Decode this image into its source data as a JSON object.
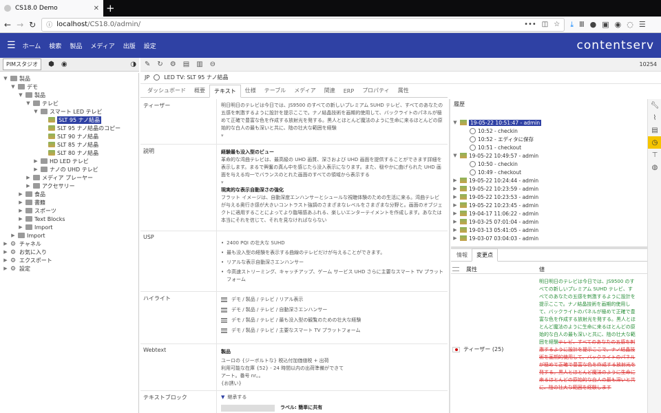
{
  "browser": {
    "tab_title": "CS18.0 Demo",
    "url_host": "localhost",
    "url_path": "/CS18.0/admin/",
    "more_label": "•••"
  },
  "app": {
    "menu": [
      "ホーム",
      "検索",
      "製品",
      "メディア",
      "出版",
      "設定"
    ],
    "logo": "contentserv",
    "accent_color": "#2f41a4",
    "record_id": "10254"
  },
  "left": {
    "tab_label": "PIMスタジオ",
    "tree": [
      {
        "label": "製品",
        "level": 0,
        "toggle": "▼",
        "icon": "fold"
      },
      {
        "label": "デモ",
        "level": 1,
        "toggle": "▼",
        "icon": "fold"
      },
      {
        "label": "製品",
        "level": 2,
        "toggle": "▼",
        "icon": "fold"
      },
      {
        "label": "テレビ",
        "level": 3,
        "toggle": "▼",
        "icon": "fold"
      },
      {
        "label": "スマート LED テレビ",
        "level": 4,
        "toggle": "▼",
        "icon": "fold"
      },
      {
        "label": "SLT 95 ナノ結晶",
        "level": 5,
        "toggle": "",
        "icon": "img",
        "selected": true
      },
      {
        "label": "SLT 95 ナノ結晶のコピー",
        "level": 5,
        "toggle": "",
        "icon": "img"
      },
      {
        "label": "SLT 90 ナノ結晶",
        "level": 5,
        "toggle": "",
        "icon": "img"
      },
      {
        "label": "SLT 85 ナノ結晶",
        "level": 5,
        "toggle": "",
        "icon": "img"
      },
      {
        "label": "SLT 80 ナノ結晶",
        "level": 5,
        "toggle": "",
        "icon": "img"
      },
      {
        "label": "HD LED テレビ",
        "level": 4,
        "toggle": "▶",
        "icon": "fold"
      },
      {
        "label": "ナノの UHD テレビ",
        "level": 4,
        "toggle": "▶",
        "icon": "fold"
      },
      {
        "label": "メディア プレーヤー",
        "level": 3,
        "toggle": "▶",
        "icon": "fold"
      },
      {
        "label": "アクセサリー",
        "level": 3,
        "toggle": "▶",
        "icon": "fold"
      },
      {
        "label": "食品",
        "level": 2,
        "toggle": "▶",
        "icon": "fold"
      },
      {
        "label": "書籍",
        "level": 2,
        "toggle": "▶",
        "icon": "fold"
      },
      {
        "label": "スポーツ",
        "level": 2,
        "toggle": "▶",
        "icon": "fold"
      },
      {
        "label": "Text Blocks",
        "level": 2,
        "toggle": "▶",
        "icon": "fold"
      },
      {
        "label": "Import",
        "level": 2,
        "toggle": "▶",
        "icon": "fold"
      },
      {
        "label": "Import",
        "level": 1,
        "toggle": "▶",
        "icon": "fold"
      },
      {
        "label": "チャネル",
        "level": 0,
        "toggle": "▶",
        "icon": "gear"
      },
      {
        "label": "お気に入り",
        "level": 0,
        "toggle": "▶",
        "icon": "gear"
      },
      {
        "label": "エクスポート",
        "level": 0,
        "toggle": "▶",
        "icon": "gear"
      },
      {
        "label": "設定",
        "level": 0,
        "toggle": "▶",
        "icon": "gear"
      }
    ]
  },
  "main": {
    "lang": "JP",
    "breadcrumb": "LED TV: SLT 95 ナノ結晶",
    "tabs": [
      "ダッシュボード",
      "概要",
      "テキスト",
      "仕様",
      "テーブル",
      "メディア",
      "関連",
      "ERP",
      "プロパティ",
      "属性"
    ],
    "active_tab": 2,
    "teaser_label": "ティーザー",
    "teaser_text": "明日明日のテレビは今日では、JS9500 のすべての新しいプレミアム SUHD テレビ、すべてのあなたの五感を刺激するように設計を提示ここで。ナノ結晶技術を画期的使用して、バックライトのパネルが極めて正確で豊富な色を作成する放射光を発する。黒人とほとんど魔法のように生命に来るほとんどの原始的な白人の最も深いと共に、陰の壮大な範囲を経験",
    "desc_label": "説明",
    "desc_h1": "経験最も没入型のビュー",
    "desc_p1": "革命的な湾曲テレビは、最高級の UHD 画質、深さおよび UHD 画面を提供することができます詳細を表示します。まるで興奮の真ん中を感じたら没入表示になります。また、穏やかに曲げられた UHD 画面を与える均一でバランスのとれた画面のすべての領域から表示する",
    "desc_h2": "現実的な表示自動深さの強化",
    "desc_p2": "フラット イメージは、自動深度エンハンサーとシュールな視聴体験のための生活に来る。湾曲テレビが与える奥行き感が大きいコントラスト強調のさまざまなレベルをさまざまな分野と。画面のオブジェクトに適用することによってより臨場感あふれる、楽しいエンターテイメントを作成します。あなたは本当にそれを信じて、それを見なければならない",
    "usp_label": "USP",
    "usp": [
      "2400 PQI の壮大な SUHD",
      "最も没入型の経験を表示する曲線のテレビだけが与えることができます。",
      "リアルな表示自動深さエンハンサー",
      "今高速ストリーミング、キャッチアップ、ゲーム サービス UHD さらに主要なスマート TV プラットフォーム"
    ],
    "hl_label": "ハイライト",
    "highlights": [
      "デモ / 製品 / テレビ / リアル表示",
      "デモ / 製品 / テレビ / 自動深さエンハンサー",
      "デモ / 製品 / テレビ / 最も没入型の観覧のための壮大な経験",
      "デモ / 製品 / テレビ / 主要なスマート TV プラットフォーム"
    ],
    "web_label": "Webtext",
    "web_title": "製品",
    "web_lines": [
      "ユーロの {ジーボルトな} 税込付加価値税 + 出荷",
      "利用可能な在庫 {52} - 24 時間以内の出荷準備ができて",
      "アート。番号 nr。。",
      "{お誘い}"
    ],
    "tb_label": "テキストブロック",
    "tb_toggle": "継承する",
    "tb_sub": "ラベル: 簡単に共有"
  },
  "history": {
    "title": "履歴",
    "items": [
      {
        "label": "19-05-22 10:51:47 - admin",
        "level": 0,
        "toggle": "▼",
        "kind": "img",
        "selected": true
      },
      {
        "label": "10:52 - checkin",
        "level": 1,
        "toggle": "",
        "kind": "clock"
      },
      {
        "label": "10:52 - エディタに保存",
        "level": 1,
        "toggle": "",
        "kind": "clock"
      },
      {
        "label": "10:51 - checkout",
        "level": 1,
        "toggle": "",
        "kind": "clock"
      },
      {
        "label": "19-05-22 10:49:57 - admin",
        "level": 0,
        "toggle": "▼",
        "kind": "img"
      },
      {
        "label": "10:50 - checkin",
        "level": 1,
        "toggle": "",
        "kind": "clock"
      },
      {
        "label": "10:49 - checkout",
        "level": 1,
        "toggle": "",
        "kind": "clock"
      },
      {
        "label": "19-05-22 10:24:44 - admin",
        "level": 0,
        "toggle": "▶",
        "kind": "img"
      },
      {
        "label": "19-05-22 10:23:59 - admin",
        "level": 0,
        "toggle": "▶",
        "kind": "img"
      },
      {
        "label": "19-05-22 10:23:53 - admin",
        "level": 0,
        "toggle": "▶",
        "kind": "img"
      },
      {
        "label": "19-05-22 10:23:45 - admin",
        "level": 0,
        "toggle": "▶",
        "kind": "img"
      },
      {
        "label": "19-04-17 11:06:22 - admin",
        "level": 0,
        "toggle": "▶",
        "kind": "img"
      },
      {
        "label": "19-03-25 07:01:04 - admin",
        "level": 0,
        "toggle": "▶",
        "kind": "img"
      },
      {
        "label": "19-03-13 05:41:05 - admin",
        "level": 0,
        "toggle": "▶",
        "kind": "img"
      },
      {
        "label": "19-03-07 03:04:03 - admin",
        "level": 0,
        "toggle": "▶",
        "kind": "img"
      }
    ],
    "tabs": [
      "情報",
      "変更点"
    ],
    "active_tab": 1,
    "col_attr": "属性",
    "col_val": "値",
    "field": "ティーザー (25)",
    "new_text": "明日明日のテレビは今日では、JS9500 のすべての新しいプレミアム SUHD テレビ、すべてのあなたの五感を刺激するように設計を提示ここで。ナノ結晶技術を画期的使用して、バックライトのパネルが極めて正確で豊富な色を作成する放射光を発する。黒人とほとんど魔法のように生命に来るほとんどの原始的な白人の最も深いと共に、陰の壮大な範囲を経験",
    "old_text": "テレビ、すべてのあなたの五感を刺激するように設計を提示ここで。ナノ結晶技術を画期的使用して、バックライトのパネルが極めて正確で豊富な色を作成する放射光を発する。黒人とほとんど魔法のように生命に来るほとんどの原始的な白人の最も深いと共に、陰の壮大な範囲を経験します"
  }
}
